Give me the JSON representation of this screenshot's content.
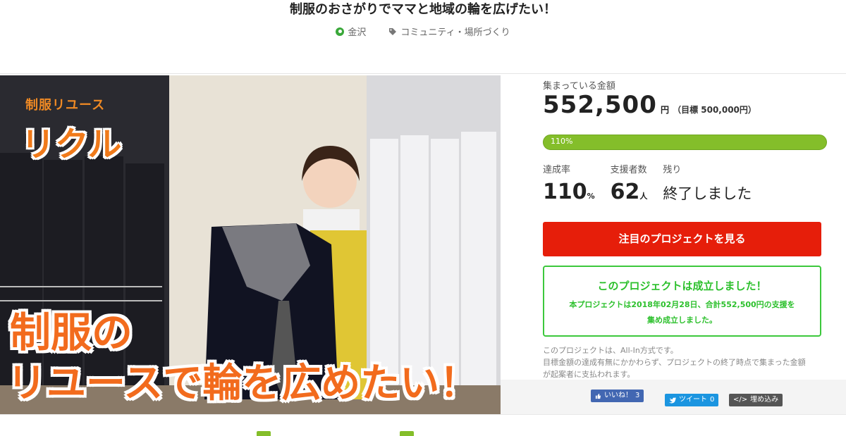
{
  "header": {
    "title": "制服のおさがりでママと地域の輪を広げたい！",
    "location": "金沢",
    "category": "コミュニティ・場所づくり"
  },
  "hero": {
    "brand_small": "制服リユース",
    "brand_logo": "リクル",
    "headline_line1": "制服の",
    "headline_line2": "リユースで輪を広めたい！"
  },
  "funding": {
    "collected_label": "集まっている金額",
    "amount": "552,500",
    "amount_unit": "円",
    "goal_text": "（目標 500,000円）",
    "progress_text": "110%",
    "progress_fraction": 1.0,
    "stats": {
      "rate_label": "達成率",
      "rate_value": "110",
      "rate_unit": "%",
      "backers_label": "支援者数",
      "backers_value": "62",
      "backers_unit": "人",
      "remaining_label": "残り",
      "remaining_value": "終了しました"
    }
  },
  "cta": {
    "label": "注目のプロジェクトを見る"
  },
  "success": {
    "title": "このプロジェクトは成立しました！",
    "line1": "本プロジェクトは2018年02月28日、合計552,500円の支援を",
    "line2": "集め成立しました。"
  },
  "note": {
    "line1": "このプロジェクトは、All-In方式です。",
    "line2": "目標金額の達成有無にかかわらず、プロジェクトの終了時点で集まった金額",
    "line3": "が起案者に支払われます。"
  },
  "share": {
    "facebook_label": "いいね！",
    "facebook_count": "3",
    "twitter_label": "ツイート",
    "twitter_count": "0",
    "embed_label": "埋め込み"
  },
  "colors": {
    "accent_green": "#84be2a",
    "cta_red": "#e61e0a",
    "success_green": "#2cc02c",
    "hero_orange": "#f26b1d"
  }
}
